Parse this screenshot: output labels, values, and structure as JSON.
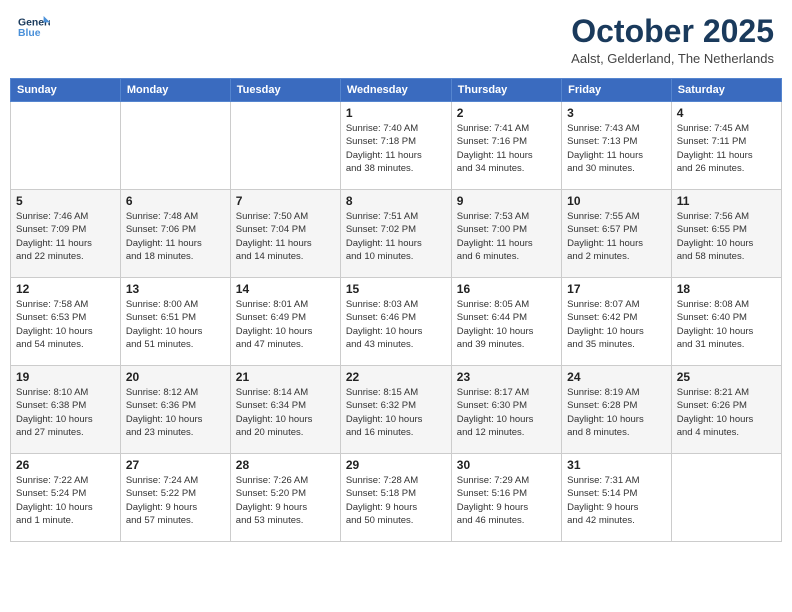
{
  "header": {
    "logo_line1": "General",
    "logo_line2": "Blue",
    "month": "October 2025",
    "location": "Aalst, Gelderland, The Netherlands"
  },
  "days_of_week": [
    "Sunday",
    "Monday",
    "Tuesday",
    "Wednesday",
    "Thursday",
    "Friday",
    "Saturday"
  ],
  "weeks": [
    [
      {
        "num": "",
        "info": ""
      },
      {
        "num": "",
        "info": ""
      },
      {
        "num": "",
        "info": ""
      },
      {
        "num": "1",
        "info": "Sunrise: 7:40 AM\nSunset: 7:18 PM\nDaylight: 11 hours\nand 38 minutes."
      },
      {
        "num": "2",
        "info": "Sunrise: 7:41 AM\nSunset: 7:16 PM\nDaylight: 11 hours\nand 34 minutes."
      },
      {
        "num": "3",
        "info": "Sunrise: 7:43 AM\nSunset: 7:13 PM\nDaylight: 11 hours\nand 30 minutes."
      },
      {
        "num": "4",
        "info": "Sunrise: 7:45 AM\nSunset: 7:11 PM\nDaylight: 11 hours\nand 26 minutes."
      }
    ],
    [
      {
        "num": "5",
        "info": "Sunrise: 7:46 AM\nSunset: 7:09 PM\nDaylight: 11 hours\nand 22 minutes."
      },
      {
        "num": "6",
        "info": "Sunrise: 7:48 AM\nSunset: 7:06 PM\nDaylight: 11 hours\nand 18 minutes."
      },
      {
        "num": "7",
        "info": "Sunrise: 7:50 AM\nSunset: 7:04 PM\nDaylight: 11 hours\nand 14 minutes."
      },
      {
        "num": "8",
        "info": "Sunrise: 7:51 AM\nSunset: 7:02 PM\nDaylight: 11 hours\nand 10 minutes."
      },
      {
        "num": "9",
        "info": "Sunrise: 7:53 AM\nSunset: 7:00 PM\nDaylight: 11 hours\nand 6 minutes."
      },
      {
        "num": "10",
        "info": "Sunrise: 7:55 AM\nSunset: 6:57 PM\nDaylight: 11 hours\nand 2 minutes."
      },
      {
        "num": "11",
        "info": "Sunrise: 7:56 AM\nSunset: 6:55 PM\nDaylight: 10 hours\nand 58 minutes."
      }
    ],
    [
      {
        "num": "12",
        "info": "Sunrise: 7:58 AM\nSunset: 6:53 PM\nDaylight: 10 hours\nand 54 minutes."
      },
      {
        "num": "13",
        "info": "Sunrise: 8:00 AM\nSunset: 6:51 PM\nDaylight: 10 hours\nand 51 minutes."
      },
      {
        "num": "14",
        "info": "Sunrise: 8:01 AM\nSunset: 6:49 PM\nDaylight: 10 hours\nand 47 minutes."
      },
      {
        "num": "15",
        "info": "Sunrise: 8:03 AM\nSunset: 6:46 PM\nDaylight: 10 hours\nand 43 minutes."
      },
      {
        "num": "16",
        "info": "Sunrise: 8:05 AM\nSunset: 6:44 PM\nDaylight: 10 hours\nand 39 minutes."
      },
      {
        "num": "17",
        "info": "Sunrise: 8:07 AM\nSunset: 6:42 PM\nDaylight: 10 hours\nand 35 minutes."
      },
      {
        "num": "18",
        "info": "Sunrise: 8:08 AM\nSunset: 6:40 PM\nDaylight: 10 hours\nand 31 minutes."
      }
    ],
    [
      {
        "num": "19",
        "info": "Sunrise: 8:10 AM\nSunset: 6:38 PM\nDaylight: 10 hours\nand 27 minutes."
      },
      {
        "num": "20",
        "info": "Sunrise: 8:12 AM\nSunset: 6:36 PM\nDaylight: 10 hours\nand 23 minutes."
      },
      {
        "num": "21",
        "info": "Sunrise: 8:14 AM\nSunset: 6:34 PM\nDaylight: 10 hours\nand 20 minutes."
      },
      {
        "num": "22",
        "info": "Sunrise: 8:15 AM\nSunset: 6:32 PM\nDaylight: 10 hours\nand 16 minutes."
      },
      {
        "num": "23",
        "info": "Sunrise: 8:17 AM\nSunset: 6:30 PM\nDaylight: 10 hours\nand 12 minutes."
      },
      {
        "num": "24",
        "info": "Sunrise: 8:19 AM\nSunset: 6:28 PM\nDaylight: 10 hours\nand 8 minutes."
      },
      {
        "num": "25",
        "info": "Sunrise: 8:21 AM\nSunset: 6:26 PM\nDaylight: 10 hours\nand 4 minutes."
      }
    ],
    [
      {
        "num": "26",
        "info": "Sunrise: 7:22 AM\nSunset: 5:24 PM\nDaylight: 10 hours\nand 1 minute."
      },
      {
        "num": "27",
        "info": "Sunrise: 7:24 AM\nSunset: 5:22 PM\nDaylight: 9 hours\nand 57 minutes."
      },
      {
        "num": "28",
        "info": "Sunrise: 7:26 AM\nSunset: 5:20 PM\nDaylight: 9 hours\nand 53 minutes."
      },
      {
        "num": "29",
        "info": "Sunrise: 7:28 AM\nSunset: 5:18 PM\nDaylight: 9 hours\nand 50 minutes."
      },
      {
        "num": "30",
        "info": "Sunrise: 7:29 AM\nSunset: 5:16 PM\nDaylight: 9 hours\nand 46 minutes."
      },
      {
        "num": "31",
        "info": "Sunrise: 7:31 AM\nSunset: 5:14 PM\nDaylight: 9 hours\nand 42 minutes."
      },
      {
        "num": "",
        "info": ""
      }
    ]
  ]
}
